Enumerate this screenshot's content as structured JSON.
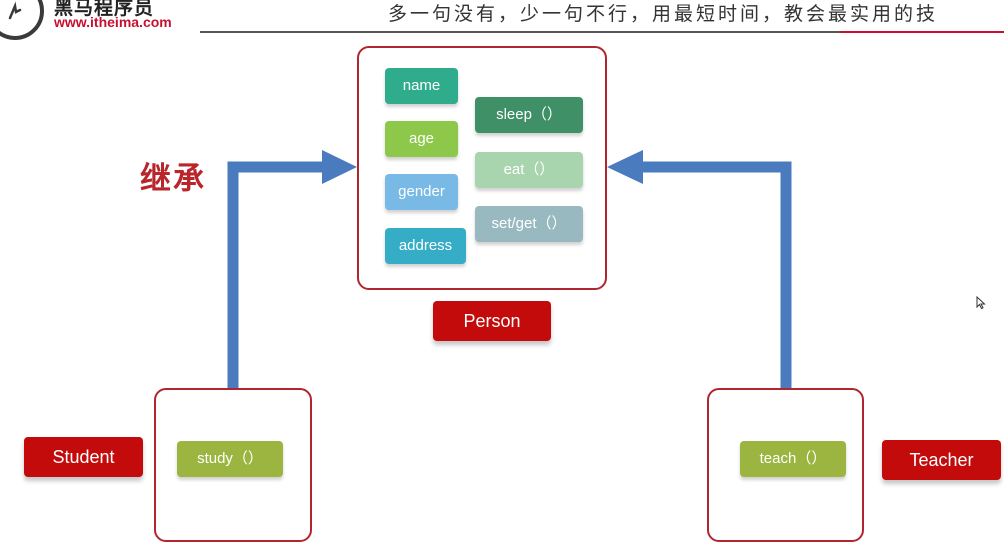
{
  "header": {
    "logo_cn": "黑马程序员",
    "logo_url": "www.itheima.com",
    "slogan": "多一句没有，少一句不行，用最短时间，教会最实用的技"
  },
  "diagram": {
    "inherit_label": "继承",
    "person": {
      "label": "Person",
      "attributes": [
        {
          "text": "name",
          "color": "#2fac8c"
        },
        {
          "text": "age",
          "color": "#8dc84a"
        },
        {
          "text": "gender",
          "color": "#78b9e6"
        },
        {
          "text": "address",
          "color": "#35adc6"
        }
      ],
      "methods": [
        {
          "text": "sleep（）",
          "color": "#3f8f67"
        },
        {
          "text": "eat（）",
          "color": "#a9d5ae"
        },
        {
          "text": "set/get（）",
          "color": "#98b9bf"
        }
      ]
    },
    "student": {
      "label": "Student",
      "methods": [
        {
          "text": "study（）",
          "color": "#9bb540"
        }
      ]
    },
    "teacher": {
      "label": "Teacher",
      "methods": [
        {
          "text": "teach（）",
          "color": "#9bb540"
        }
      ]
    },
    "colors": {
      "frame": "#b0262e",
      "label_bg": "#c40b0b",
      "arrow": "#4a7bbf",
      "inherit_text": "#b8262c"
    }
  }
}
